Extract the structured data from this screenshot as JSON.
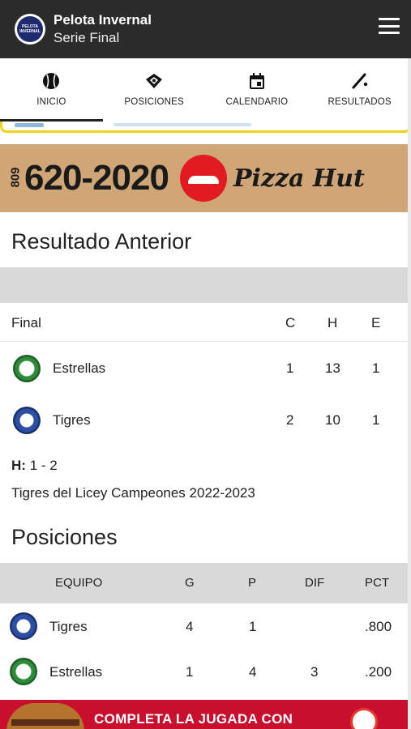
{
  "header": {
    "title": "Pelota Invernal",
    "subtitle": "Serie Final",
    "logo_text": "PELOTA INVERNAL"
  },
  "tabs": [
    {
      "label": "INICIO",
      "icon": "baseball-icon"
    },
    {
      "label": "POSICIONES",
      "icon": "diamond-icon"
    },
    {
      "label": "CALENDARIO",
      "icon": "calendar-icon"
    },
    {
      "label": "RESULTADOS",
      "icon": "bat-icon"
    }
  ],
  "ad_top": {
    "prefix": "809",
    "phone": "620-2020",
    "brand": "Pizza Hut"
  },
  "previous_result": {
    "title": "Resultado Anterior",
    "status": "Final",
    "columns": [
      "C",
      "H",
      "E"
    ],
    "teams": [
      {
        "name": "Estrellas",
        "c": "1",
        "h": "13",
        "e": "1",
        "logo": "estrellas-logo"
      },
      {
        "name": "Tigres",
        "c": "2",
        "h": "10",
        "e": "1",
        "logo": "tigres-logo"
      }
    ],
    "series_label": "H:",
    "series_value": "1 - 2",
    "note": "Tigres del Licey Campeones 2022-2023"
  },
  "standings": {
    "title": "Posiciones",
    "columns": {
      "team": "EQUIPO",
      "g": "G",
      "p": "P",
      "dif": "DIF",
      "pct": "PCT"
    },
    "rows": [
      {
        "name": "Tigres",
        "g": "4",
        "p": "1",
        "dif": "",
        "pct": ".800",
        "logo": "tigres-logo"
      },
      {
        "name": "Estrellas",
        "g": "1",
        "p": "4",
        "dif": "3",
        "pct": ".200",
        "logo": "estrellas-logo"
      }
    ]
  },
  "ad_bottom": {
    "text": "COMPLETA LA JUGADA CON"
  },
  "colors": {
    "header_bg": "#2b2b2b",
    "accent_yellow": "#f3d21f",
    "grey_bar": "#d9d9d9",
    "promo_red": "#c8102e"
  }
}
